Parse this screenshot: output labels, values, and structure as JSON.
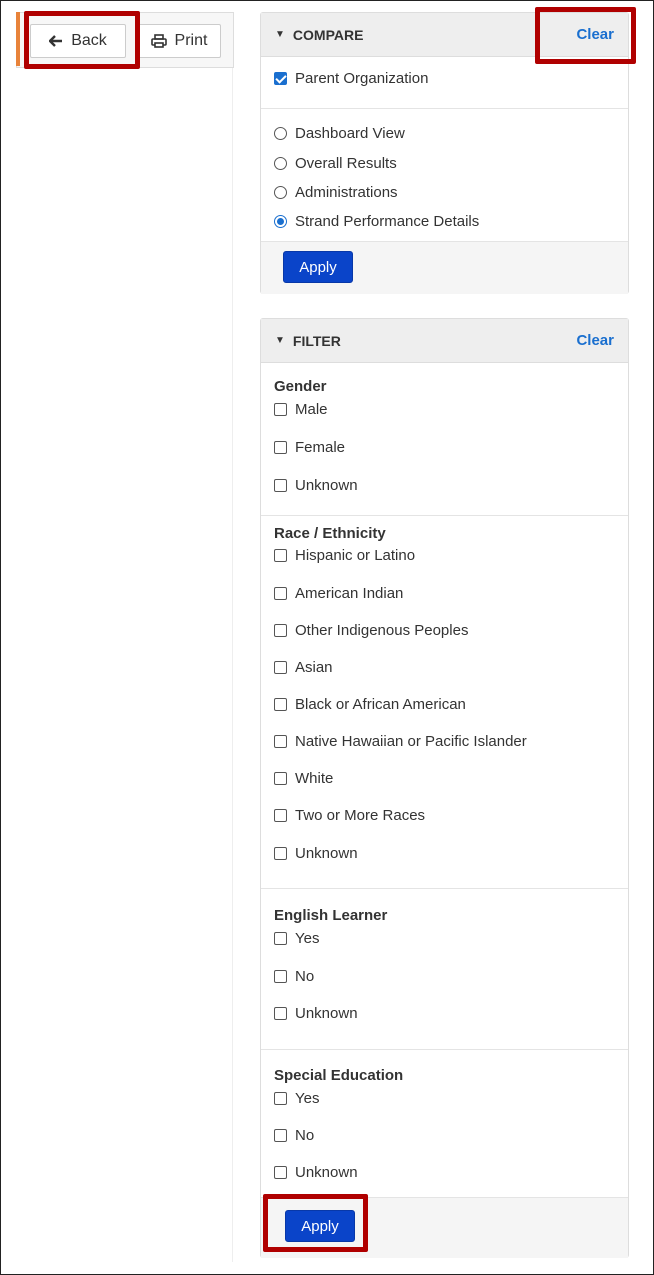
{
  "toolbar": {
    "back_label": "Back",
    "print_label": "Print",
    "back_icon": "arrow-left-icon",
    "print_icon": "printer-icon"
  },
  "compare": {
    "title": "COMPARE",
    "clear_label": "Clear",
    "parent_org": {
      "label": "Parent Organization",
      "checked": true
    },
    "views": [
      {
        "label": "Dashboard View",
        "selected": false
      },
      {
        "label": "Overall Results",
        "selected": false
      },
      {
        "label": "Administrations",
        "selected": false
      },
      {
        "label": "Strand Performance Details",
        "selected": true
      }
    ],
    "apply_label": "Apply"
  },
  "filter": {
    "title": "FILTER",
    "clear_label": "Clear",
    "groups": [
      {
        "label": "Gender",
        "options": [
          "Male",
          "Female",
          "Unknown"
        ]
      },
      {
        "label": "Race / Ethnicity",
        "options": [
          "Hispanic or Latino",
          "American Indian",
          "Other Indigenous Peoples",
          "Asian",
          "Black or African American",
          "Native Hawaiian or Pacific Islander",
          "White",
          "Two or More Races",
          "Unknown"
        ]
      },
      {
        "label": "English Learner",
        "options": [
          "Yes",
          "No",
          "Unknown"
        ]
      },
      {
        "label": "Special Education",
        "options": [
          "Yes",
          "No",
          "Unknown"
        ]
      }
    ],
    "apply_label": "Apply"
  },
  "colors": {
    "highlight": "#b00000",
    "accent": "#e8833a",
    "link": "#1a6fcf",
    "primary_button": "#0a44c9"
  }
}
